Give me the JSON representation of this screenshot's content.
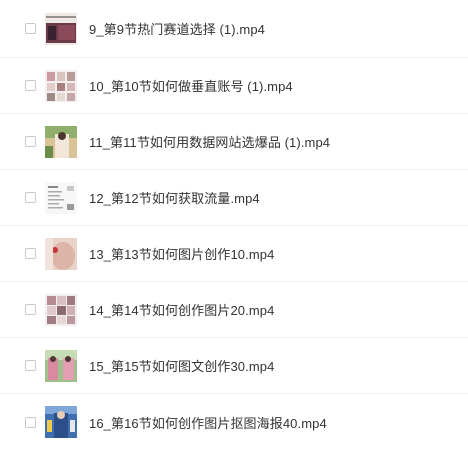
{
  "files": [
    {
      "name": "9_第9节热门赛道选择 (1).mp4",
      "thumbnail": "video-thumbnail"
    },
    {
      "name": "10_第10节如何做垂直账号 (1).mp4",
      "thumbnail": "video-thumbnail"
    },
    {
      "name": "11_第11节如何用数据网站选爆品 (1).mp4",
      "thumbnail": "video-thumbnail"
    },
    {
      "name": "12_第12节如何获取流量.mp4",
      "thumbnail": "video-thumbnail"
    },
    {
      "name": "13_第13节如何图片创作10.mp4",
      "thumbnail": "video-thumbnail"
    },
    {
      "name": "14_第14节如何创作图片20.mp4",
      "thumbnail": "video-thumbnail"
    },
    {
      "name": "15_第15节如何图文创作30.mp4",
      "thumbnail": "video-thumbnail"
    },
    {
      "name": "16_第16节如何创作图片抠图海报40.mp4",
      "thumbnail": "video-thumbnail"
    }
  ]
}
